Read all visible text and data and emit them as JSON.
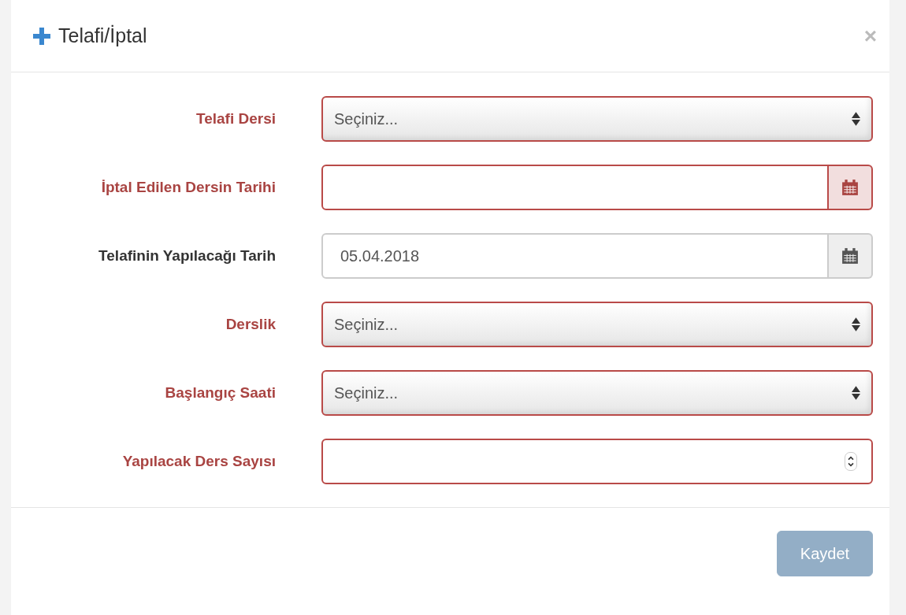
{
  "dialog": {
    "title": "Telafi/İptal",
    "close": "×"
  },
  "fields": [
    {
      "label": "Telafi Dersi",
      "kind": "select",
      "error": true,
      "value": "Seçiniz..."
    },
    {
      "label": "İptal Edilen Dersin Tarihi",
      "kind": "date",
      "error": true
    },
    {
      "label": "Telafinin Yapılacağı Tarih",
      "kind": "date",
      "error": false,
      "value": "05.04.2018"
    },
    {
      "label": "Derslik",
      "kind": "select",
      "error": true,
      "value": "Seçiniz..."
    },
    {
      "label": "Başlangıç Saati",
      "kind": "select",
      "error": true,
      "value": "Seçiniz..."
    },
    {
      "label": "Yapılacak Ders Sayısı",
      "kind": "number",
      "error": true
    }
  ],
  "footer": {
    "button": {
      "label": "Kaydet",
      "disabled": true
    }
  }
}
